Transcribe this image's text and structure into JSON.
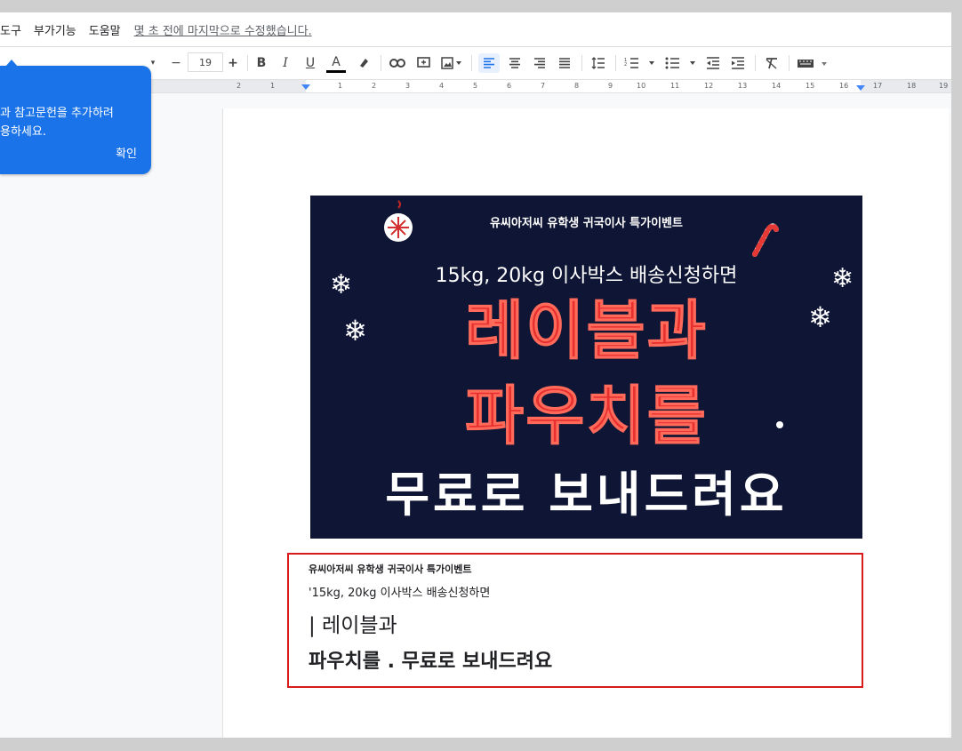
{
  "menu": {
    "items": [
      "도구",
      "부가기능",
      "도움말"
    ],
    "last_edited": "몇 초 전에 마지막으로 수정했습니다."
  },
  "toolbar": {
    "font_size": "19",
    "decrease_label": "−",
    "increase_label": "+",
    "bold": "B",
    "italic": "I",
    "underline": "U",
    "text_color": "A",
    "accent_color": "#1a73e8"
  },
  "ruler": {
    "labels": [
      "2",
      "1",
      "1",
      "2",
      "3",
      "4",
      "5",
      "6",
      "7",
      "8",
      "9",
      "10",
      "11",
      "12",
      "13",
      "14",
      "15",
      "16",
      "17",
      "18",
      "19"
    ]
  },
  "tooltip": {
    "line1": "과 참고문헌을 추가하려",
    "line2": "용하세요.",
    "confirm": "확인"
  },
  "banner": {
    "top_line": "유씨아저씨 유학생 귀국이사 특가이벤트",
    "line2": "15kg, 20kg 이사박스 배송신청하면",
    "red1": "레이블과",
    "red2": "파우치를",
    "white": "무료로 보내드려요",
    "bg_color": "#0f1535",
    "red_color": "#e8302f"
  },
  "ocr_box": {
    "line1": "유씨아저씨 유학생 귀국이사 특가이벤트",
    "line2": "'15kg, 20kg 이사박스 배송신청하면",
    "line3": "| 레이블과",
    "line4": "파우치를 . 무료로 보내드려요",
    "border_color": "#d81b1b"
  }
}
